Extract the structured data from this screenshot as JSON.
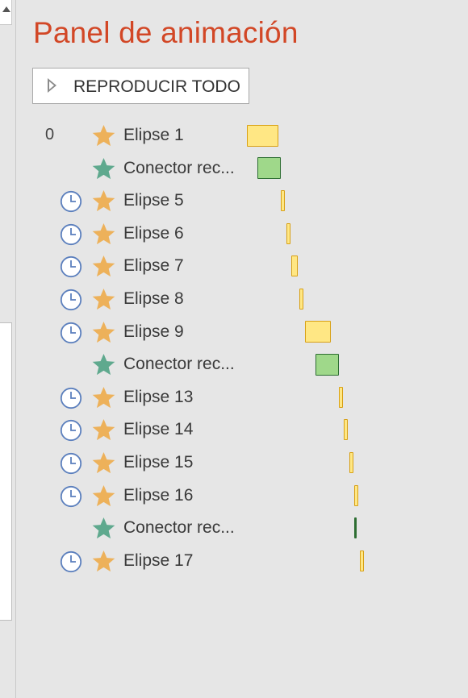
{
  "panel": {
    "title": "Panel de animación",
    "play_all_label": "REPRODUCIR TODO"
  },
  "colors": {
    "title": "#d24726",
    "star_gold": "#edb15a",
    "star_teal": "#5fa98e",
    "clock": "#5b7fbd",
    "bar_yellow_fill": "#ffe784",
    "bar_yellow_border": "#d8a014",
    "bar_green_fill": "#9fd88a",
    "bar_green_border": "#2d6e32"
  },
  "animations": [
    {
      "index": "0",
      "trigger": "click",
      "effect": "star-gold",
      "name": "Elipse 1",
      "bar": "yellow",
      "start": 0,
      "duration": 12
    },
    {
      "index": "",
      "trigger": "with",
      "effect": "star-teal",
      "name": "Conector rec...",
      "bar": "green",
      "start": 4,
      "duration": 9
    },
    {
      "index": "",
      "trigger": "after",
      "effect": "star-gold",
      "name": "Elipse 5",
      "bar": "yellow",
      "start": 13,
      "duration": 1.5
    },
    {
      "index": "",
      "trigger": "after",
      "effect": "star-gold",
      "name": "Elipse 6",
      "bar": "yellow",
      "start": 15,
      "duration": 1.5
    },
    {
      "index": "",
      "trigger": "after",
      "effect": "star-gold",
      "name": "Elipse 7",
      "bar": "yellow",
      "start": 17,
      "duration": 2.5
    },
    {
      "index": "",
      "trigger": "after",
      "effect": "star-gold",
      "name": "Elipse 8",
      "bar": "yellow",
      "start": 20,
      "duration": 1.5
    },
    {
      "index": "",
      "trigger": "after",
      "effect": "star-gold",
      "name": "Elipse 9",
      "bar": "yellow",
      "start": 22,
      "duration": 10
    },
    {
      "index": "",
      "trigger": "with",
      "effect": "star-teal",
      "name": "Conector rec...",
      "bar": "green",
      "start": 26,
      "duration": 9
    },
    {
      "index": "",
      "trigger": "after",
      "effect": "star-gold",
      "name": "Elipse 13",
      "bar": "yellow",
      "start": 35,
      "duration": 1.5
    },
    {
      "index": "",
      "trigger": "after",
      "effect": "star-gold",
      "name": "Elipse 14",
      "bar": "yellow",
      "start": 37,
      "duration": 1.5
    },
    {
      "index": "",
      "trigger": "after",
      "effect": "star-gold",
      "name": "Elipse 15",
      "bar": "yellow",
      "start": 39,
      "duration": 1.5
    },
    {
      "index": "",
      "trigger": "after",
      "effect": "star-gold",
      "name": "Elipse 16",
      "bar": "yellow",
      "start": 41,
      "duration": 1.5
    },
    {
      "index": "",
      "trigger": "with",
      "effect": "star-teal",
      "name": "Conector rec...",
      "bar": "green",
      "start": 41,
      "duration": 0.5
    },
    {
      "index": "",
      "trigger": "after",
      "effect": "star-gold",
      "name": "Elipse 17",
      "bar": "yellow",
      "start": 43,
      "duration": 1.5
    }
  ]
}
